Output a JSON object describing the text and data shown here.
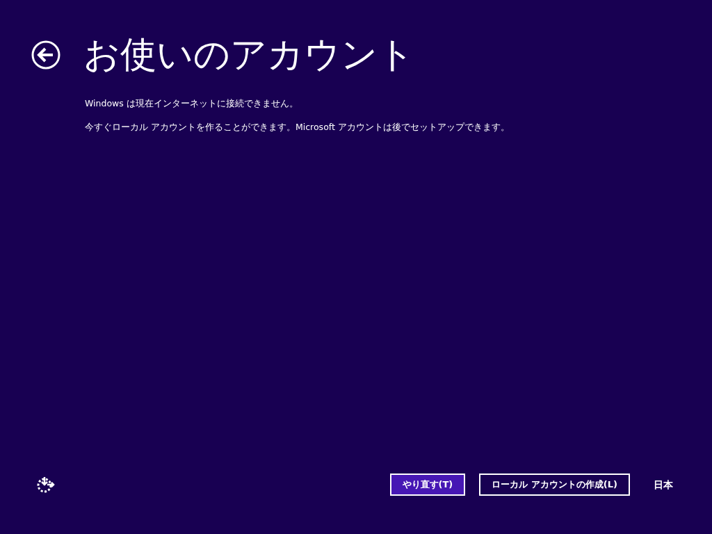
{
  "title": "お使いのアカウント",
  "paragraphs": [
    "Windows は現在インターネットに接続できません。",
    "今すぐローカル アカウントを作ることができます。Microsoft アカウントは後でセットアップできます。"
  ],
  "buttons": [
    {
      "label": "やり直す(T)",
      "kind": "filled"
    },
    {
      "label": "ローカル アカウントの作成(L)",
      "kind": "outlined"
    }
  ],
  "language": "日本"
}
